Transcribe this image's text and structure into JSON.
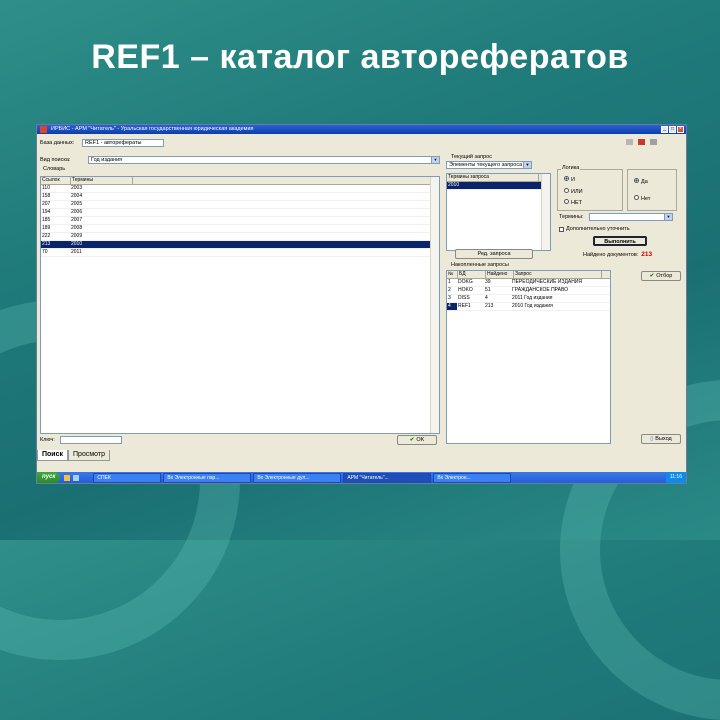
{
  "slide": {
    "title": "REF1 – каталог авторефератов"
  },
  "window": {
    "title": "ИРБИС - АРМ \"Читатель\" - Уральская государственная юридическая академия",
    "db_label": "База данных:",
    "db_value": "REF1 - авторефераты",
    "search_type_label": "Вид поиска:",
    "search_type_value": "Год издания",
    "dictionary_title": "Словарь",
    "dict_columns": [
      "Ссылок",
      "Термины"
    ],
    "dict_rows": [
      {
        "count": "110",
        "term": "2003"
      },
      {
        "count": "158",
        "term": "2004"
      },
      {
        "count": "207",
        "term": "2005"
      },
      {
        "count": "194",
        "term": "2006"
      },
      {
        "count": "185",
        "term": "2007"
      },
      {
        "count": "189",
        "term": "2008"
      },
      {
        "count": "222",
        "term": "2009"
      },
      {
        "count": "213",
        "term": "2010",
        "selected": true
      },
      {
        "count": "70",
        "term": "2011"
      }
    ],
    "key_label": "Ключ:",
    "key_value": "",
    "current_query_title": "Текущий запрос",
    "current_query_combo": "Элементы текущего запроса",
    "query_terms_column": "Термины запроса",
    "query_terms": [
      "2010"
    ],
    "logic_label": "Логика",
    "logic_options": [
      "И",
      "ИЛИ",
      "НЕТ"
    ],
    "logic_selected": "И",
    "truncation_options": [
      "Да",
      "Нет"
    ],
    "truncation_selected": "Да",
    "terms_label": "Термины:",
    "precise_label": "Дополнительно уточнить",
    "run_button": "Выполнить",
    "found_label": "Найдено документов:",
    "found_count": "213",
    "edit_query_button": "Ред. запроса",
    "accumulated_title": "Накопленные запросы",
    "acc_columns": [
      "№",
      "БД",
      "Найдено",
      "Запрос"
    ],
    "acc_rows": [
      {
        "n": "1",
        "db": "DOKG",
        "found": "39",
        "q": "ПЕРЕОДИЧЕСКИЕ ИЗДАНИЯ"
      },
      {
        "n": "2",
        "db": "HOKO",
        "found": "51",
        "q": "ГРАЖДАНСКОЕ ПРАВО"
      },
      {
        "n": "3",
        "db": "DISS",
        "found": "4",
        "q": "2011 Год издания"
      },
      {
        "n": "4",
        "db": "REF1",
        "found": "213",
        "q": "2010 Год издания",
        "selected": true
      }
    ],
    "choice_button": "Отбор",
    "ok_button": "OK",
    "exit_button": "Выход",
    "tabs": [
      "Поиск",
      "Просмотр"
    ]
  },
  "taskbar": {
    "start": "пуск",
    "items": [
      "СПЕК",
      "Вх Электронные пар...",
      "Вх Электронные дул...",
      "АРМ \"Читатель\"...",
      "Вх Электрон..."
    ],
    "active_index": 3,
    "clock": "11:16"
  }
}
